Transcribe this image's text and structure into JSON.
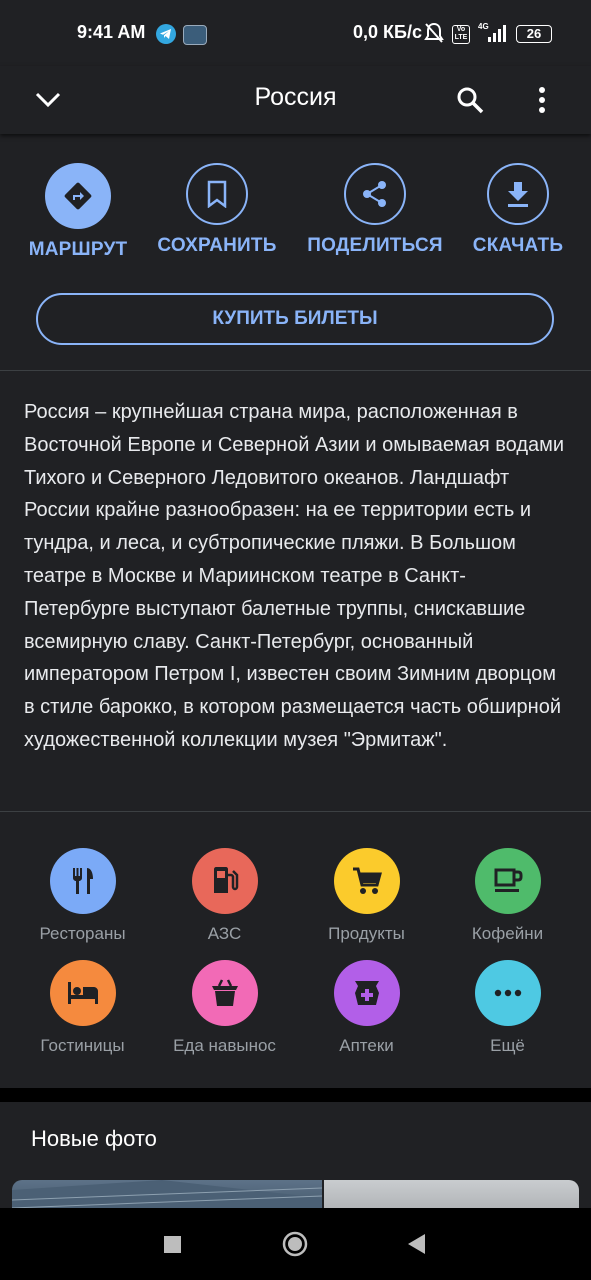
{
  "status_bar": {
    "time": "9:41 AM",
    "network_speed": "0,0 КБ/с",
    "volte": "Vo LTE",
    "signal": "4G",
    "battery": "26"
  },
  "app_bar": {
    "title": "Россия",
    "back_icon": "chevron-down-icon",
    "search_icon": "search-icon",
    "more_icon": "more-vert-icon"
  },
  "actions": [
    {
      "label": "МАРШРУТ",
      "icon": "directions-icon"
    },
    {
      "label": "СОХРАНИТЬ",
      "icon": "bookmark-icon"
    },
    {
      "label": "ПОДЕЛИТЬСЯ",
      "icon": "share-icon"
    },
    {
      "label": "СКАЧАТЬ",
      "icon": "download-icon"
    }
  ],
  "buy_tickets": "КУПИТЬ БИЛЕТЫ",
  "description": "Россия – крупнейшая страна мира, расположенная в Восточной Европе и Северной Азии и омываемая водами Тихого и Северного Ледовитого океанов. Ландшафт России крайне разнообразен: на ее территории есть и тундра, и леса, и субтропические пляжи. В Большом театре в Москве и Мариинском театре в Санкт-Петербурге выступают балетные труппы, снискавшие всемирную славу. Санкт-Петербург, основанный императором Петром I, известен своим Зимним дворцом в стиле барокко, в котором размещается часть обширной художественной коллекции музея \"Эрмитаж\".",
  "categories": [
    {
      "label": "Рестораны",
      "icon": "restaurant-icon",
      "color": "#7baaf7"
    },
    {
      "label": "АЗС",
      "icon": "gas-station-icon",
      "color": "#e8685a"
    },
    {
      "label": "Продукты",
      "icon": "cart-icon",
      "color": "#fbcb2c"
    },
    {
      "label": "Кофейни",
      "icon": "coffee-icon",
      "color": "#4fbb6b"
    },
    {
      "label": "Гостиницы",
      "icon": "hotel-icon",
      "color": "#f58a3e"
    },
    {
      "label": "Еда навынос",
      "icon": "takeout-icon",
      "color": "#f26ab6"
    },
    {
      "label": "Аптеки",
      "icon": "pharmacy-icon",
      "color": "#b25fe8"
    },
    {
      "label": "Ещё",
      "icon": "more-horiz-icon",
      "color": "#4ec9e3"
    }
  ],
  "photos": {
    "title": "Новые фото"
  },
  "colors": {
    "accent": "#8ab4f8",
    "background": "#202124"
  }
}
